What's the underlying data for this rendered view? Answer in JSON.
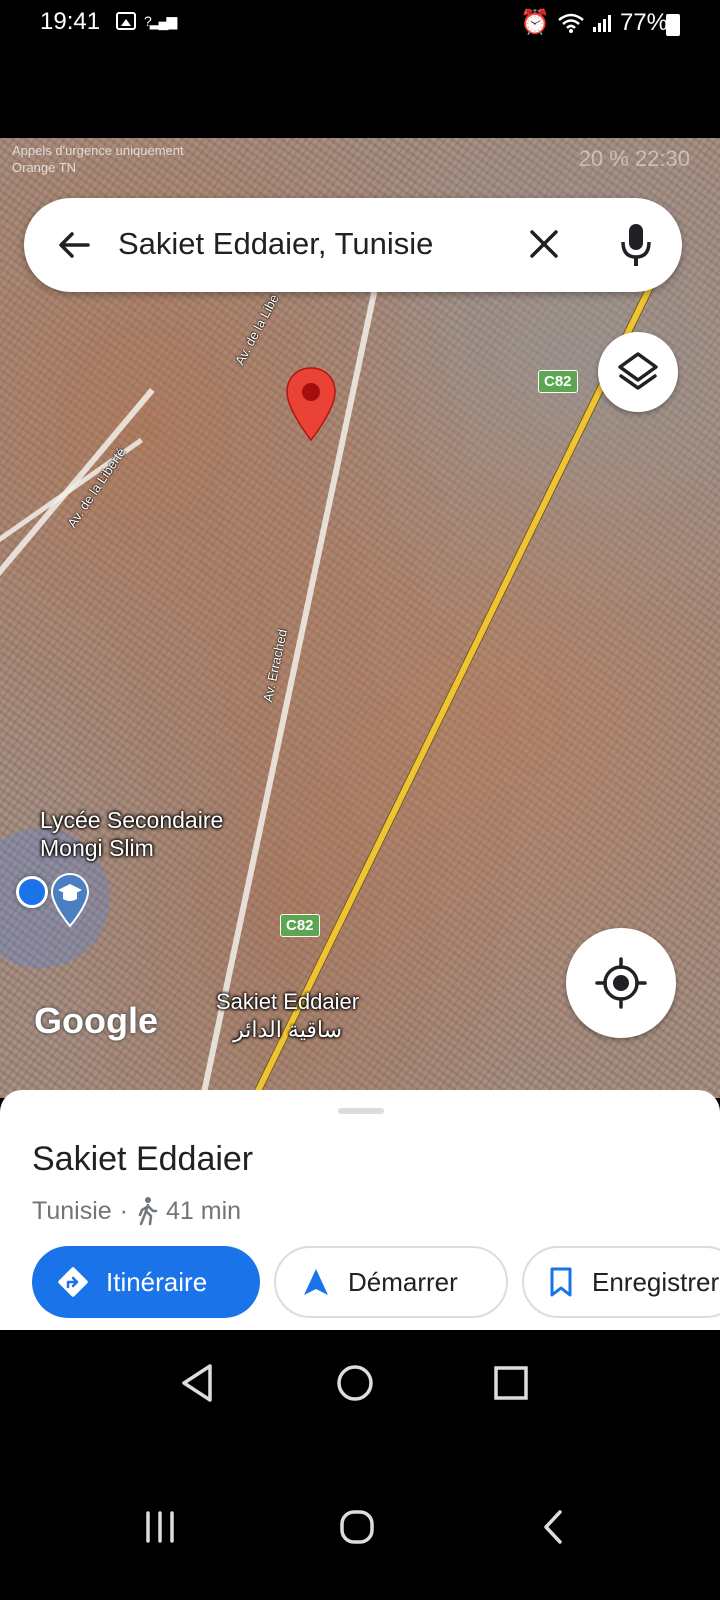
{
  "status_bar": {
    "time": "19:41",
    "battery": "77%"
  },
  "map": {
    "inner_status": {
      "line1": "Appels d'urgence uniquement",
      "line2": "Orange TN",
      "right": "20 %  22:30"
    },
    "search": {
      "query": "Sakiet Eddaier, Tunisie"
    },
    "road_labels": {
      "liberte_top": "Av. de la Libe",
      "liberte": "Av. de la Liberté",
      "errached": "Av. Errached",
      "c82_top": "C82",
      "c82_bottom": "C82"
    },
    "poi": {
      "school_line1": "Lycée Secondaire",
      "school_line2": "Mongi Slim"
    },
    "town_label": {
      "latin": "Sakiet Eddaier",
      "arabic": "ساقية الدائر"
    },
    "logo": "Google"
  },
  "place": {
    "title": "Sakiet Eddaier",
    "country": "Tunisie",
    "separator": "·",
    "walk_time": "41 min"
  },
  "actions": {
    "directions": "Itinéraire",
    "start": "Démarrer",
    "save": "Enregistrer"
  },
  "colors": {
    "accent": "#1a73e8",
    "pin": "#ea4335",
    "route_shield": "#5ca653"
  }
}
